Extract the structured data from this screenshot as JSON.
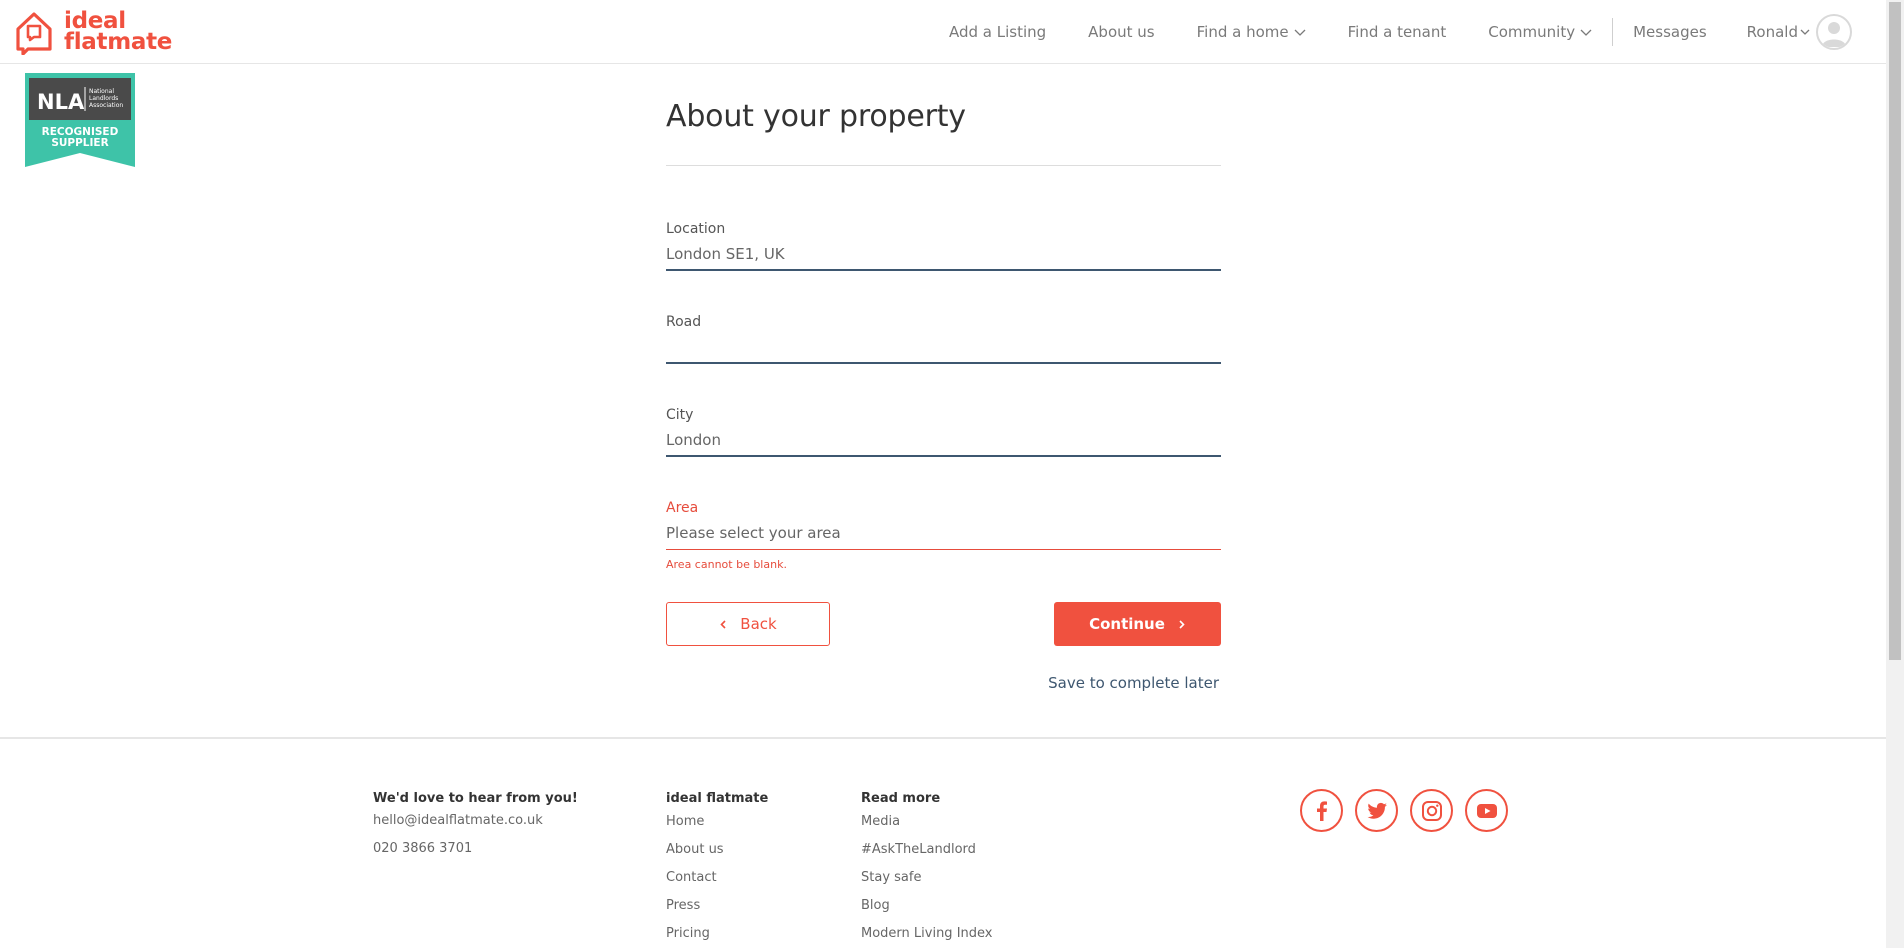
{
  "brand": {
    "name_line1": "ideal",
    "name_line2": "flatmate",
    "accent": "#f0513f",
    "underline_color": "#3e5770"
  },
  "nav": {
    "items": [
      {
        "label": "Add a Listing",
        "dropdown": false
      },
      {
        "label": "About us",
        "dropdown": false
      },
      {
        "label": "Find a home",
        "dropdown": true
      },
      {
        "label": "Find a tenant",
        "dropdown": false
      },
      {
        "label": "Community",
        "dropdown": true
      }
    ],
    "messages": "Messages",
    "user": "Ronald"
  },
  "badge": {
    "org": "NLA",
    "org_full": "National Landlords Association",
    "line1": "RECOGNISED",
    "line2": "SUPPLIER"
  },
  "form": {
    "title": "About your property",
    "fields": {
      "location": {
        "label": "Location",
        "value": "London SE1, UK"
      },
      "road": {
        "label": "Road",
        "value": ""
      },
      "city": {
        "label": "City",
        "value": "London"
      },
      "area": {
        "label": "Area",
        "value": "Please select your area",
        "error": "Area cannot be blank."
      }
    },
    "back": "Back",
    "continue": "Continue",
    "save_later": "Save to complete later"
  },
  "footer": {
    "contact": {
      "heading": "We'd love to hear from you!",
      "email": "hello@idealflatmate.co.uk",
      "phone": "020 3866 3701"
    },
    "company": {
      "heading": "ideal flatmate",
      "links": [
        "Home",
        "About us",
        "Contact",
        "Press",
        "Pricing"
      ]
    },
    "read_more": {
      "heading": "Read more",
      "links": [
        "Media",
        "#AskTheLandlord",
        "Stay safe",
        "Blog",
        "Modern Living Index"
      ]
    },
    "social": [
      "facebook-icon",
      "twitter-icon",
      "instagram-icon",
      "youtube-icon"
    ]
  }
}
